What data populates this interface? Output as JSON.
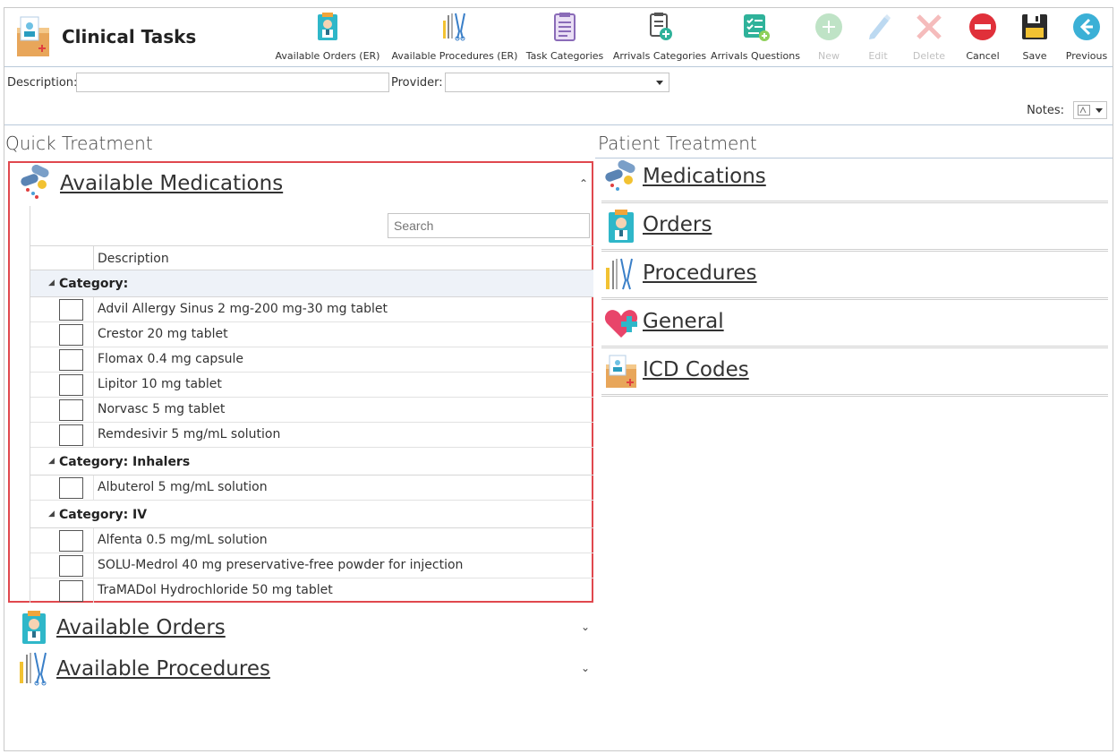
{
  "header": {
    "title": "Clinical Tasks",
    "toolbar": [
      {
        "label": "Available Orders (ER)",
        "icon": "doctor-clipboard-icon",
        "enabled": true
      },
      {
        "label": "Available Procedures (ER)",
        "icon": "surgical-tools-icon",
        "enabled": true
      },
      {
        "label": "Task Categories",
        "icon": "list-document-icon",
        "enabled": true
      },
      {
        "label": "Arrivals Categories",
        "icon": "document-add-icon",
        "enabled": true
      },
      {
        "label": "Arrivals Questions",
        "icon": "checklist-add-icon",
        "enabled": true
      },
      {
        "label": "New",
        "icon": "plus-circle-icon",
        "enabled": false
      },
      {
        "label": "Edit",
        "icon": "pencil-icon",
        "enabled": false
      },
      {
        "label": "Delete",
        "icon": "x-icon",
        "enabled": false
      },
      {
        "label": "Cancel",
        "icon": "no-entry-icon",
        "enabled": true
      },
      {
        "label": "Save",
        "icon": "floppy-disk-icon",
        "enabled": true
      },
      {
        "label": "Previous",
        "icon": "back-arrow-icon",
        "enabled": true
      }
    ]
  },
  "filters": {
    "description_label": "Description:",
    "description_value": "",
    "provider_label": "Provider:",
    "provider_value": "",
    "notes_label": "Notes:"
  },
  "quick_treatment": {
    "title": "Quick Treatment",
    "medications": {
      "title": "Available Medications",
      "search_placeholder": "Search",
      "column_description": "Description",
      "groups": [
        {
          "label": "Category:",
          "items": [
            "Advil Allergy Sinus 2 mg-200 mg-30 mg tablet",
            "Crestor 20 mg tablet",
            "Flomax 0.4 mg capsule",
            "Lipitor 10 mg tablet",
            "Norvasc 5 mg tablet",
            "Remdesivir 5 mg/mL solution"
          ]
        },
        {
          "label": "Category: Inhalers",
          "items": [
            "Albuterol 5 mg/mL solution"
          ]
        },
        {
          "label": "Category: IV",
          "items": [
            "Alfenta 0.5 mg/mL solution",
            "SOLU-Medrol 40 mg preservative-free powder for injection",
            "TraMADol Hydrochloride 50 mg tablet"
          ]
        }
      ]
    },
    "orders_title": "Available Orders",
    "procedures_title": "Available Procedures"
  },
  "patient_treatment": {
    "title": "Patient Treatment",
    "items": [
      "Medications",
      "Orders",
      "Procedures",
      "General",
      "ICD Codes"
    ]
  },
  "colors": {
    "highlight_border": "#e0484e",
    "group_selected_bg": "#eef2f8"
  }
}
